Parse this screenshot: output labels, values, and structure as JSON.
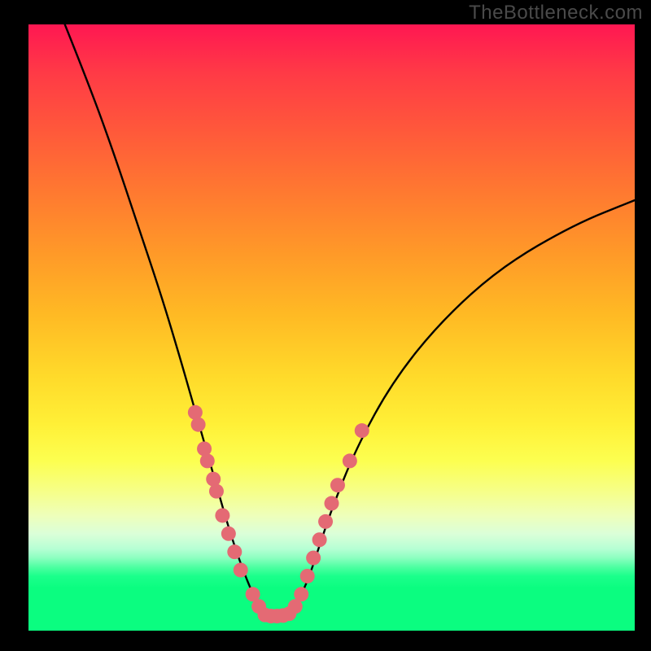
{
  "watermark": "TheBottleneck.com",
  "chart_data": {
    "type": "line",
    "title": "",
    "xlabel": "",
    "ylabel": "",
    "xlim": [
      0,
      100
    ],
    "ylim": [
      0,
      100
    ],
    "curve": {
      "x": [
        6,
        10,
        14,
        18,
        22,
        25,
        27,
        29,
        31,
        33,
        35,
        37,
        38.5,
        40,
        42,
        44,
        46,
        48,
        50,
        54,
        60,
        68,
        78,
        90,
        100
      ],
      "y": [
        100,
        90,
        79,
        67,
        55,
        45,
        38,
        31,
        24,
        17,
        11,
        6,
        3.5,
        2.5,
        2.5,
        4,
        8,
        14,
        20,
        30,
        41,
        51,
        60,
        67,
        71
      ]
    },
    "dots_left": {
      "x": [
        27.5,
        28,
        29,
        29.5,
        30.5,
        31,
        32,
        33,
        34,
        35,
        37,
        38
      ],
      "y": [
        36,
        34,
        30,
        28,
        25,
        23,
        19,
        16,
        13,
        10,
        6,
        4
      ]
    },
    "dots_bottom": {
      "x": [
        39,
        40,
        41,
        42,
        43
      ],
      "y": [
        2.6,
        2.4,
        2.4,
        2.5,
        2.8
      ]
    },
    "dots_right": {
      "x": [
        44,
        45,
        46,
        47,
        48,
        49,
        50,
        51,
        53,
        55
      ],
      "y": [
        4,
        6,
        9,
        12,
        15,
        18,
        21,
        24,
        28,
        33
      ]
    },
    "dot_color": "#e46a74",
    "dot_radius": 9
  }
}
